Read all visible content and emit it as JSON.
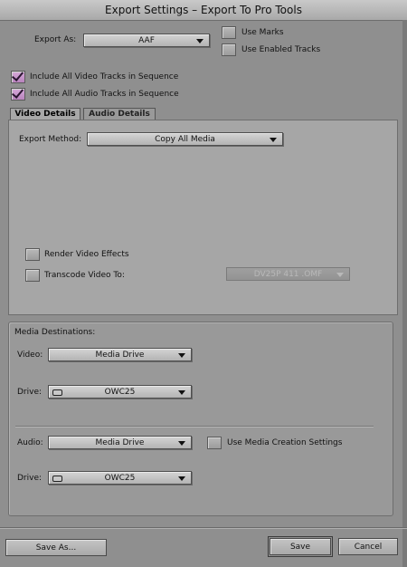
{
  "window": {
    "title": "Export Settings – Export To Pro Tools"
  },
  "export_as": {
    "label": "Export As:",
    "value": "AAF"
  },
  "options": {
    "use_marks": "Use Marks",
    "use_enabled_tracks": "Use Enabled Tracks",
    "include_video": "Include All Video Tracks in Sequence",
    "include_audio": "Include All Audio Tracks in Sequence"
  },
  "tabs": [
    {
      "label": "Video Details",
      "active": true
    },
    {
      "label": "Audio Details",
      "active": false
    }
  ],
  "video_details": {
    "export_method_label": "Export Method:",
    "export_method_value": "Copy All Media",
    "render_effects": "Render Video Effects",
    "transcode_label": "Transcode Video To:",
    "transcode_value": "DV25P 411 .OMF"
  },
  "media_destinations": {
    "heading": "Media Destinations:",
    "video_label": "Video:",
    "video_value": "Media Drive",
    "video_drive_label": "Drive:",
    "video_drive_value": "OWC25",
    "audio_label": "Audio:",
    "audio_value": "Media Drive",
    "use_media_creation": "Use Media Creation Settings",
    "audio_drive_label": "Drive:",
    "audio_drive_value": "OWC25"
  },
  "buttons": {
    "save_as": "Save As...",
    "save": "Save",
    "cancel": "Cancel"
  },
  "colors": {
    "check_fill": "#c795cc",
    "background": "#8f8f8f"
  }
}
